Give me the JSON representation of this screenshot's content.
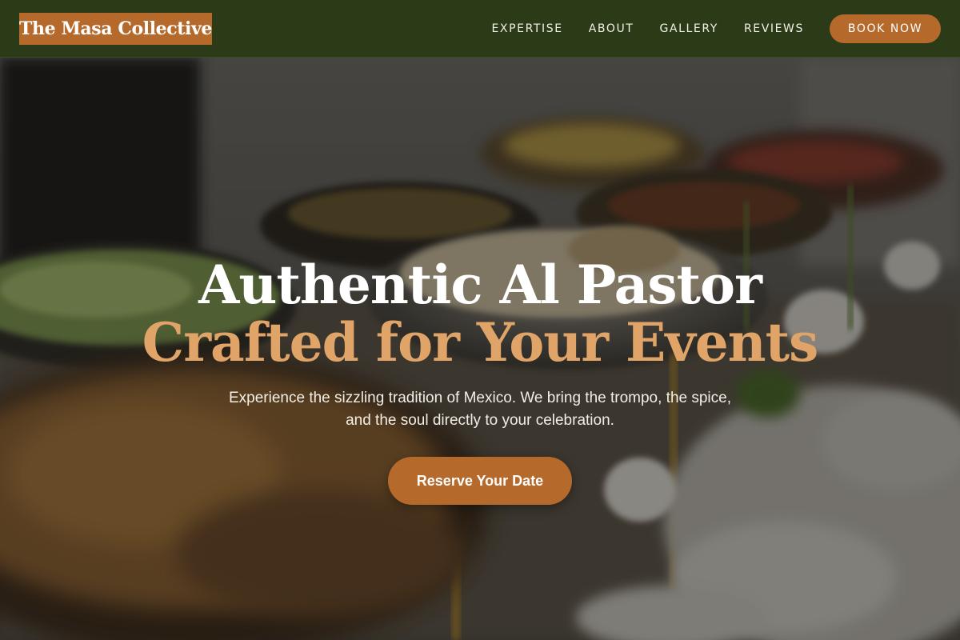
{
  "brand": {
    "name": "The Masa Collective",
    "color": "#b56a2c"
  },
  "nav": {
    "links": [
      "EXPERTISE",
      "ABOUT",
      "GALLERY",
      "REVIEWS"
    ],
    "cta": "BOOK NOW"
  },
  "hero": {
    "headline_line1": "Authentic Al Pastor",
    "headline_line2": "Crafted for Your Events",
    "subtext": "Experience the sizzling tradition of Mexico. We bring the trompo, the spice, and the soul directly to your celebration.",
    "cta": "Reserve Your Date",
    "background_image": "catering-buffet-photo"
  },
  "colors": {
    "navbar": "#2b3a17",
    "accent": "#b56a2c",
    "headline_accent": "#e0a468"
  }
}
